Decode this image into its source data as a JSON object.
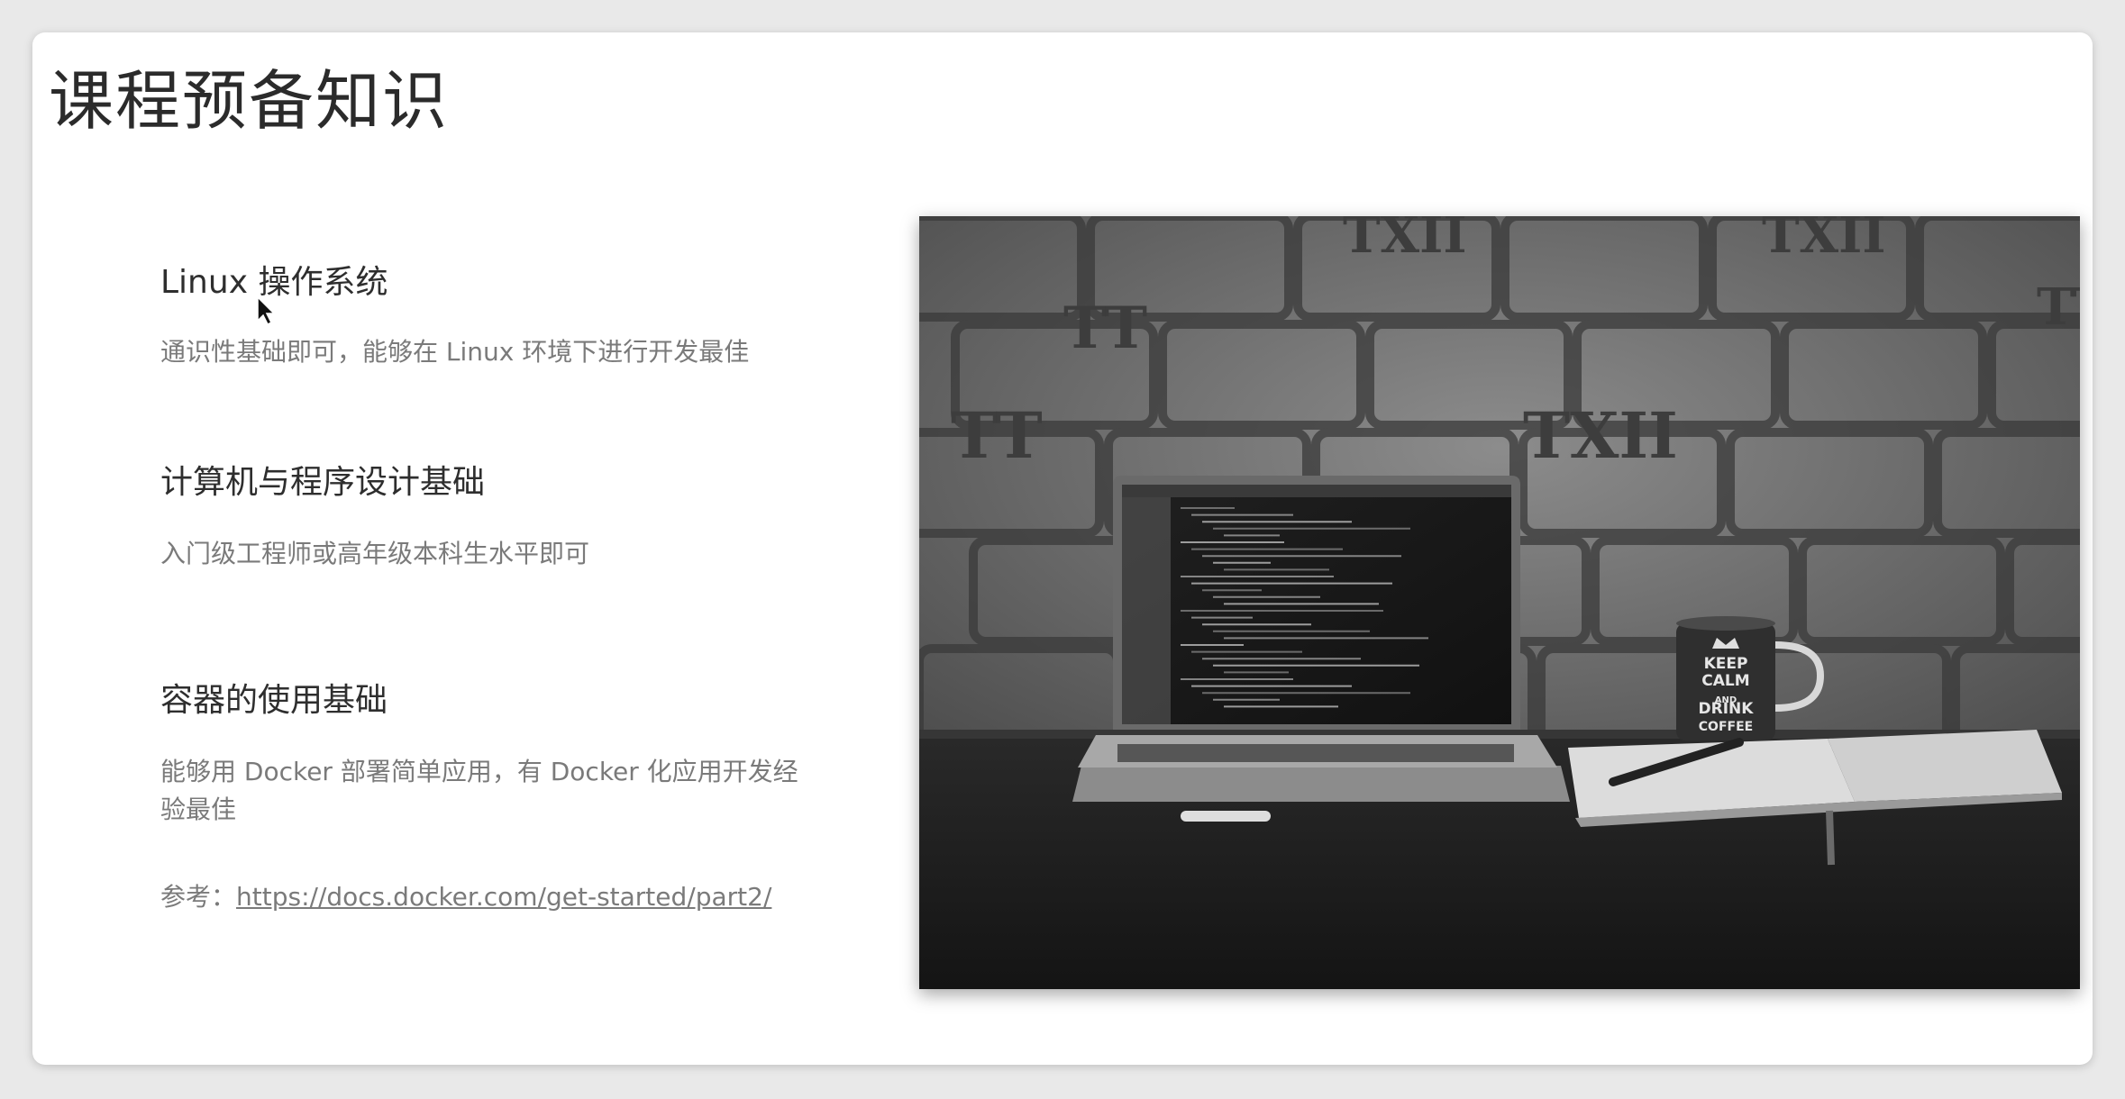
{
  "slide": {
    "title": "课程预备知识",
    "sections": [
      {
        "heading": "Linux 操作系统",
        "description": "通识性基础即可，能够在 Linux 环境下进行开发最佳"
      },
      {
        "heading": "计算机与程序设计基础",
        "description": "入门级工程师或高年级本科生水平即可"
      },
      {
        "heading": "容器的使用基础",
        "description": "能够用 Docker 部署简单应用，有 Docker 化应用开发经验最佳"
      }
    ],
    "reference": {
      "prefix": "参考：",
      "url": "https://docs.docker.com/get-started/part2/"
    }
  },
  "photo": {
    "wall_marks": [
      "TXII",
      "TT",
      "TXII",
      "TT",
      "TXII",
      "TT"
    ],
    "mug_text": [
      "KEEP",
      "CALM",
      "AND",
      "DRINK",
      "COFFEE"
    ]
  }
}
